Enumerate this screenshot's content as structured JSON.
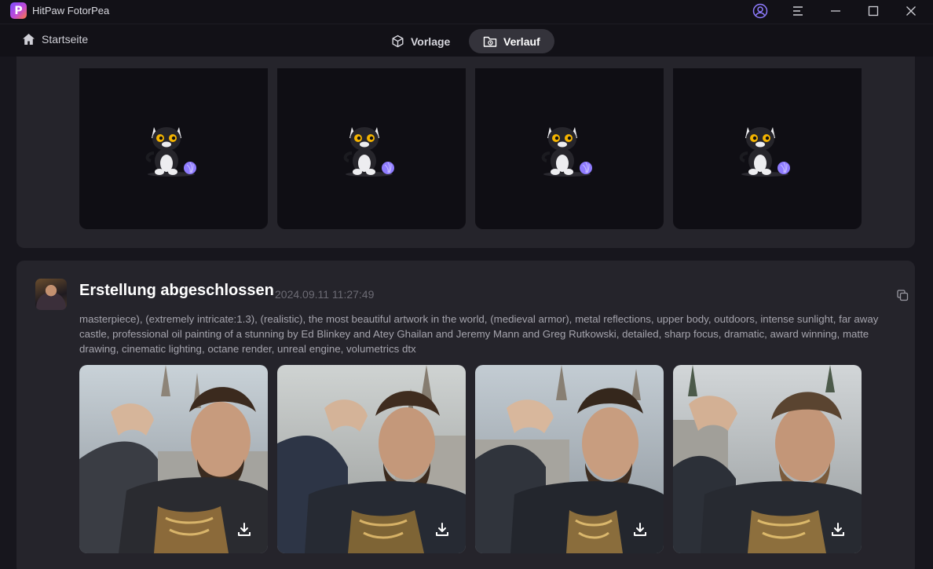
{
  "window": {
    "app_name": "HitPaw FotorPea",
    "logo_letter": "P",
    "controls": [
      "account-icon",
      "menu-icon",
      "minimize-icon",
      "maximize-icon",
      "close-icon"
    ]
  },
  "nav": {
    "home_label": "Startseite",
    "tabs": [
      {
        "label": "Vorlage",
        "icon": "cube-icon",
        "active": false
      },
      {
        "label": "Verlauf",
        "icon": "folder-history-icon",
        "active": true
      }
    ]
  },
  "pending_task": {
    "placeholder_icon": "cat-with-yarn-loading-icon",
    "tile_count": 4
  },
  "completed_task": {
    "status": "Erstellung abgeschlossen",
    "timestamp": "2024.09.11 11:27:49",
    "prompt": "masterpiece), (extremely intricate:1.3), (realistic), the most beautiful artwork in the world, (medieval armor), metal reflections, upper body, outdoors, intense sunlight, far away castle, professional oil painting of a stunning by Ed Blinkey and Atey Ghailan and Jeremy Mann and Greg Rutkowski, detailed, sharp focus, dramatic, award winning, matte drawing, cinematic lighting, octane render, unreal engine, volumetrics dtx",
    "results": [
      {
        "alt": "medieval armored man portrait 1",
        "action_icon": "download-icon"
      },
      {
        "alt": "medieval armored man portrait 2",
        "action_icon": "download-icon"
      },
      {
        "alt": "medieval armored man portrait 3",
        "action_icon": "download-icon"
      },
      {
        "alt": "medieval armored man portrait 4",
        "action_icon": "download-icon"
      }
    ]
  },
  "colors": {
    "background": "#17161d",
    "card": "#25242b",
    "titlebar": "#121117",
    "active_tab": "#34333b",
    "accent_purple": "#8f7cff",
    "timestamp": "#6c6b74"
  }
}
